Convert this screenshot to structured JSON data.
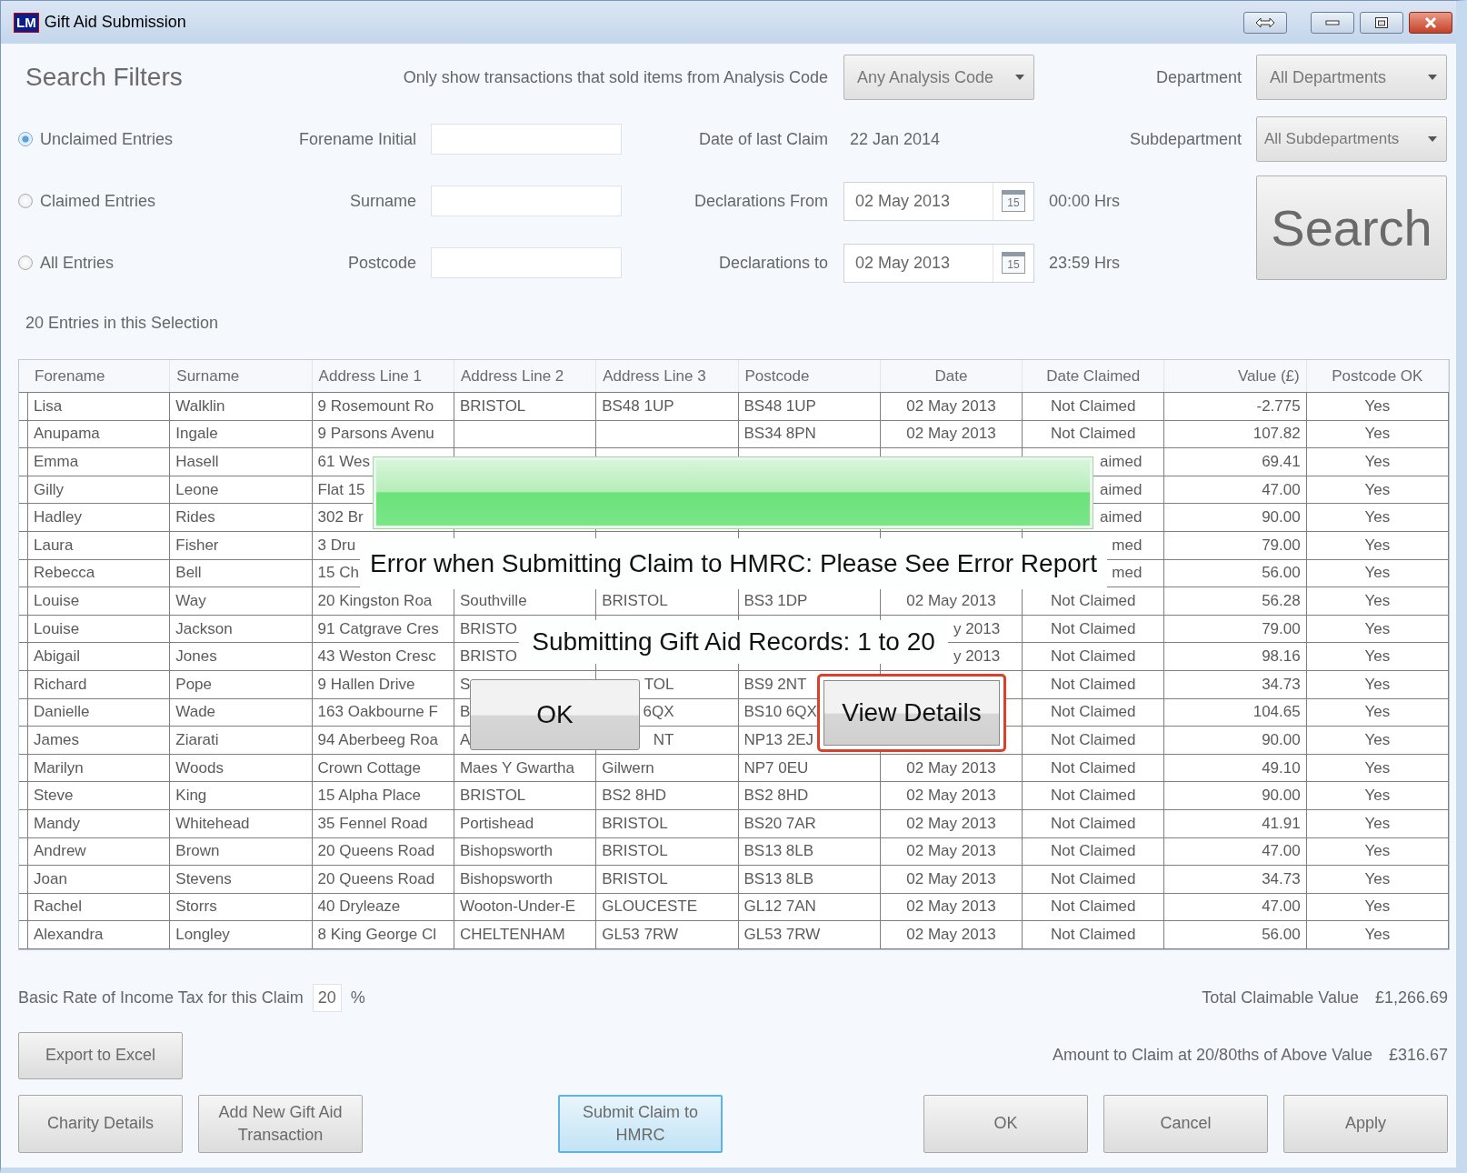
{
  "window": {
    "title": "Gift Aid Submission",
    "logo": "LM"
  },
  "filters": {
    "heading": "Search Filters",
    "analysis_label": "Only show transactions that sold items from Analysis Code",
    "analysis_code": "Any Analysis Code",
    "department_label": "Department",
    "department": "All Departments",
    "subdepartment_label": "Subdepartment",
    "subdepartment": "All Subdepartments",
    "entry_options": [
      {
        "label": "Unclaimed Entries",
        "selected": true
      },
      {
        "label": "Claimed Entries",
        "selected": false
      },
      {
        "label": "All Entries",
        "selected": false
      }
    ],
    "name_fields": [
      {
        "label": "Forename Initial"
      },
      {
        "label": "Surname"
      },
      {
        "label": "Postcode"
      }
    ],
    "last_claim_label": "Date of last Claim",
    "last_claim": "22 Jan 2014",
    "date_fields": [
      {
        "label": "Declarations From",
        "value": "02 May 2013",
        "calendar_day": "15",
        "time": "00:00 Hrs"
      },
      {
        "label": "Declarations to",
        "value": "02 May 2013",
        "calendar_day": "15",
        "time": "23:59 Hrs"
      }
    ],
    "search_button": "Search"
  },
  "entry_count": "20 Entries in this Selection",
  "table": {
    "columns": [
      "Forename",
      "Surname",
      "Address Line 1",
      "Address Line 2",
      "Address Line 3",
      "Postcode",
      "Date",
      "Date Claimed",
      "Value (£)",
      "Postcode OK"
    ],
    "rows": [
      {
        "cells": [
          "Lisa",
          "Walklin",
          "9 Rosemount Ro",
          "BRISTOL",
          "BS48 1UP",
          "BS48 1UP",
          "02 May 2013",
          "Not Claimed",
          "-2.775",
          "Yes"
        ]
      },
      {
        "cells": [
          "Anupama",
          "Ingale",
          "9 Parsons Avenu",
          null,
          null,
          "BS34 8PN",
          "02 May 2013",
          "Not Claimed",
          "107.82",
          "Yes"
        ]
      },
      {
        "cells": [
          "Emma",
          "Hasell",
          "61 Wes",
          null,
          null,
          null,
          null,
          {
            "text": "aimed",
            "cut_left": true
          },
          "69.41",
          "Yes"
        ]
      },
      {
        "cells": [
          "Gilly",
          "Leone",
          "Flat 15",
          null,
          null,
          null,
          null,
          {
            "text": "aimed",
            "cut_left": true
          },
          "47.00",
          "Yes"
        ]
      },
      {
        "cells": [
          "Hadley",
          "Rides",
          "302 Br",
          null,
          null,
          null,
          null,
          {
            "text": "aimed",
            "cut_left": true
          },
          "90.00",
          "Yes"
        ]
      },
      {
        "cells": [
          "Laura",
          "Fisher",
          "3 Dru",
          null,
          null,
          null,
          null,
          {
            "text": "med",
            "cut_left": true
          },
          "79.00",
          "Yes"
        ]
      },
      {
        "cells": [
          "Rebecca",
          "Bell",
          "15 Ch",
          null,
          null,
          null,
          null,
          {
            "text": "med",
            "cut_left": true
          },
          "56.00",
          "Yes"
        ]
      },
      {
        "cells": [
          "Louise",
          "Way",
          "20 Kingston Roa",
          "Southville",
          "BRISTOL",
          "BS3 1DP",
          "02 May 2013",
          "Not Claimed",
          "56.28",
          "Yes"
        ]
      },
      {
        "cells": [
          "Louise",
          "Jackson",
          "91 Catgrave Cres",
          "BRISTO",
          null,
          null,
          {
            "text": "y 2013",
            "cut_left": true
          },
          "Not Claimed",
          "79.00",
          "Yes"
        ]
      },
      {
        "cells": [
          "Abigail",
          "Jones",
          "43 Weston Cresc",
          "BRISTO",
          null,
          null,
          {
            "text": "y 2013",
            "cut_left": true
          },
          "Not Claimed",
          "98.16",
          "Yes"
        ]
      },
      {
        "cells": [
          "Richard",
          "Pope",
          "9 Hallen Drive",
          "S",
          {
            "text": "TOL",
            "cut_left": true
          },
          "BS9 2NT",
          null,
          "Not Claimed",
          "34.73",
          "Yes"
        ]
      },
      {
        "cells": [
          "Danielle",
          "Wade",
          "163 Oakbourne F",
          "B",
          {
            "text": "6QX",
            "cut_left": true
          },
          "BS10 6QX",
          null,
          "Not Claimed",
          "104.65",
          "Yes"
        ]
      },
      {
        "cells": [
          "James",
          "Ziarati",
          "94 Aberbeeg Roa",
          "A",
          {
            "text": "NT",
            "cut_left": true
          },
          "NP13 2EJ",
          null,
          "Not Claimed",
          "90.00",
          "Yes"
        ]
      },
      {
        "cells": [
          "Marilyn",
          "Woods",
          "Crown Cottage",
          "Maes Y Gwartha",
          "Gilwern",
          "NP7 0EU",
          "02 May 2013",
          "Not Claimed",
          "49.10",
          "Yes"
        ]
      },
      {
        "cells": [
          "Steve",
          "King",
          "15 Alpha Place",
          "BRISTOL",
          "BS2 8HD",
          "BS2 8HD",
          "02 May 2013",
          "Not Claimed",
          "90.00",
          "Yes"
        ]
      },
      {
        "cells": [
          "Mandy",
          "Whitehead",
          "35 Fennel Road",
          "Portishead",
          "BRISTOL",
          "BS20 7AR",
          "02 May 2013",
          "Not Claimed",
          "41.91",
          "Yes"
        ]
      },
      {
        "cells": [
          "Andrew",
          "Brown",
          "20 Queens Road",
          "Bishopsworth",
          "BRISTOL",
          "BS13 8LB",
          "02 May 2013",
          "Not Claimed",
          "47.00",
          "Yes"
        ]
      },
      {
        "cells": [
          "Joan",
          "Stevens",
          "20 Queens Road",
          "Bishopsworth",
          "BRISTOL",
          "BS13 8LB",
          "02 May 2013",
          "Not Claimed",
          "34.73",
          "Yes"
        ]
      },
      {
        "cells": [
          "Rachel",
          "Storrs",
          "40 Dryleaze",
          "Wooton-Under-E",
          "GLOUCESTE",
          "GL12 7AN",
          "02 May 2013",
          "Not Claimed",
          "47.00",
          "Yes"
        ]
      },
      {
        "cells": [
          "Alexandra",
          "Longley",
          "8 King George Cl",
          "CHELTENHAM",
          "GL53 7RW",
          "GL53 7RW",
          "02 May 2013",
          "Not Claimed",
          "56.00",
          "Yes"
        ]
      }
    ]
  },
  "dialog": {
    "progress": {
      "level": 1
    },
    "message": "Error when Submitting Claim to HMRC: Please See Error Report",
    "status": "Submitting Gift Aid Records: 1 to 20",
    "buttons": [
      {
        "label": "OK",
        "focused": false
      },
      {
        "label": "View Details",
        "focused": true
      }
    ]
  },
  "footer": {
    "tax_label": "Basic Rate of Income Tax for this Claim",
    "tax_rate": "20",
    "tax_unit": "%",
    "total_label": "Total Claimable Value",
    "total_value": "£1,266.69",
    "export_button": "Export to Excel",
    "amount_label": "Amount to Claim at 20/80ths of Above Value",
    "amount_value": "£316.67",
    "buttons": [
      {
        "label": "Charity Details",
        "focused": false
      },
      {
        "label": "Add New Gift Aid Transaction",
        "focused": false
      },
      {
        "label": "Submit Claim to HMRC",
        "focused": true
      },
      {
        "label": "OK",
        "focused": false
      },
      {
        "label": "Cancel",
        "focused": false
      },
      {
        "label": "Apply",
        "focused": false
      }
    ]
  }
}
